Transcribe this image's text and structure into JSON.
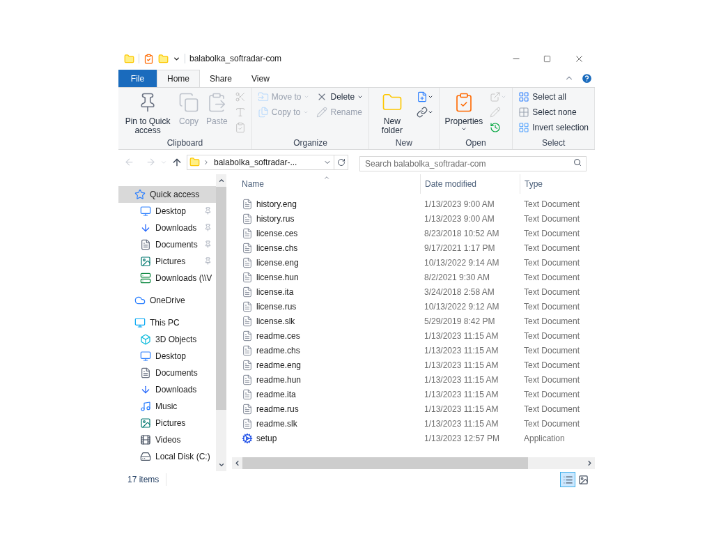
{
  "window": {
    "title": "balabolka_softradar-com"
  },
  "tabs": [
    {
      "label": "File",
      "kind": "file",
      "selected": false
    },
    {
      "label": "Home",
      "kind": "tab",
      "selected": true
    },
    {
      "label": "Share",
      "kind": "tab",
      "selected": false
    },
    {
      "label": "View",
      "kind": "tab",
      "selected": false
    }
  ],
  "ribbon": [
    {
      "label": "Clipboard",
      "columns": [
        [
          {
            "kind": "pin",
            "label": "Pin to Quick access",
            "disabled": false
          }
        ],
        [
          {
            "kind": "copy",
            "label": "Copy",
            "disabled": true
          }
        ],
        [
          {
            "kind": "paste",
            "label": "Paste",
            "disabled": true
          }
        ],
        [
          {
            "kind": "cut",
            "disabled": true
          },
          {
            "kind": "copy-path",
            "disabled": true
          },
          {
            "kind": "paste-shortcut",
            "disabled": true
          }
        ]
      ]
    },
    {
      "label": "Organize",
      "columns": [
        [
          {
            "kind": "move-to",
            "label": "Move to",
            "disabled": true
          },
          {
            "kind": "copy-to",
            "label": "Copy to",
            "disabled": true
          }
        ],
        [
          {
            "kind": "delete",
            "label": "Delete",
            "disabled": false
          },
          {
            "kind": "rename",
            "label": "Rename",
            "disabled": true
          }
        ]
      ]
    },
    {
      "label": "New",
      "columns": [
        [
          {
            "kind": "new-folder",
            "label": "New folder",
            "disabled": false
          }
        ],
        [
          {
            "kind": "new-item",
            "disabled": false
          },
          {
            "kind": "easy-access",
            "disabled": false
          }
        ]
      ]
    },
    {
      "label": "Open",
      "columns": [
        [
          {
            "kind": "properties",
            "label": "Properties",
            "disabled": false
          }
        ],
        [
          {
            "kind": "open",
            "disabled": true
          },
          {
            "kind": "edit",
            "disabled": true
          },
          {
            "kind": "history",
            "disabled": false
          }
        ]
      ]
    },
    {
      "label": "Select",
      "columns": [
        [
          {
            "kind": "select-all",
            "label": "Select all",
            "disabled": false
          },
          {
            "kind": "select-none",
            "label": "Select none",
            "disabled": false
          },
          {
            "kind": "invert",
            "label": "Invert selection",
            "disabled": false
          }
        ]
      ]
    }
  ],
  "address": {
    "path": "balabolka_softradar-...",
    "search_placeholder": "Search balabolka_softradar-com"
  },
  "nav": [
    {
      "label": "Quick access",
      "kind": "quick",
      "selected": true,
      "children": [
        {
          "label": "Desktop",
          "kind": "desktop",
          "pinned": true
        },
        {
          "label": "Downloads",
          "kind": "downloads",
          "pinned": true
        },
        {
          "label": "Documents",
          "kind": "documents",
          "pinned": true
        },
        {
          "label": "Pictures",
          "kind": "pictures",
          "pinned": true
        },
        {
          "label": "Downloads (\\\\V",
          "kind": "network",
          "pinned": false
        }
      ]
    },
    {
      "label": "OneDrive",
      "kind": "cloud",
      "selected": false
    },
    {
      "label": "This PC",
      "kind": "pc",
      "selected": false,
      "children": [
        {
          "label": "3D Objects",
          "kind": "objects"
        },
        {
          "label": "Desktop",
          "kind": "desktop"
        },
        {
          "label": "Documents",
          "kind": "documents"
        },
        {
          "label": "Downloads",
          "kind": "downloads"
        },
        {
          "label": "Music",
          "kind": "music"
        },
        {
          "label": "Pictures",
          "kind": "pictures"
        },
        {
          "label": "Videos",
          "kind": "videos"
        },
        {
          "label": "Local Disk (C:)",
          "kind": "disk"
        }
      ]
    }
  ],
  "table": {
    "columns": [
      "Name",
      "Date modified",
      "Type"
    ],
    "rows": [
      {
        "name": "history.eng",
        "date": "1/13/2023 9:00 AM",
        "type": "Text Document",
        "kind": "text"
      },
      {
        "name": "history.rus",
        "date": "1/13/2023 9:00 AM",
        "type": "Text Document",
        "kind": "text"
      },
      {
        "name": "license.ces",
        "date": "8/23/2018 10:52 AM",
        "type": "Text Document",
        "kind": "text"
      },
      {
        "name": "license.chs",
        "date": "9/17/2021 1:17 PM",
        "type": "Text Document",
        "kind": "text"
      },
      {
        "name": "license.eng",
        "date": "10/13/2022 9:14 AM",
        "type": "Text Document",
        "kind": "text"
      },
      {
        "name": "license.hun",
        "date": "8/2/2021 9:30 AM",
        "type": "Text Document",
        "kind": "text"
      },
      {
        "name": "license.ita",
        "date": "3/24/2018 2:58 AM",
        "type": "Text Document",
        "kind": "text"
      },
      {
        "name": "license.rus",
        "date": "10/13/2022 9:12 AM",
        "type": "Text Document",
        "kind": "text"
      },
      {
        "name": "license.slk",
        "date": "5/29/2019 8:42 PM",
        "type": "Text Document",
        "kind": "text"
      },
      {
        "name": "readme.ces",
        "date": "1/13/2023 11:15 AM",
        "type": "Text Document",
        "kind": "text"
      },
      {
        "name": "readme.chs",
        "date": "1/13/2023 11:15 AM",
        "type": "Text Document",
        "kind": "text"
      },
      {
        "name": "readme.eng",
        "date": "1/13/2023 11:15 AM",
        "type": "Text Document",
        "kind": "text"
      },
      {
        "name": "readme.hun",
        "date": "1/13/2023 11:15 AM",
        "type": "Text Document",
        "kind": "text"
      },
      {
        "name": "readme.ita",
        "date": "1/13/2023 11:15 AM",
        "type": "Text Document",
        "kind": "text"
      },
      {
        "name": "readme.rus",
        "date": "1/13/2023 11:15 AM",
        "type": "Text Document",
        "kind": "text"
      },
      {
        "name": "readme.slk",
        "date": "1/13/2023 11:15 AM",
        "type": "Text Document",
        "kind": "text"
      },
      {
        "name": "setup",
        "date": "1/13/2023 12:57 PM",
        "type": "Application",
        "kind": "app"
      }
    ]
  },
  "status_bar": {
    "count": "17 items",
    "views": [
      {
        "kind": "details",
        "selected": true
      },
      {
        "kind": "large-icons",
        "selected": false
      }
    ]
  }
}
